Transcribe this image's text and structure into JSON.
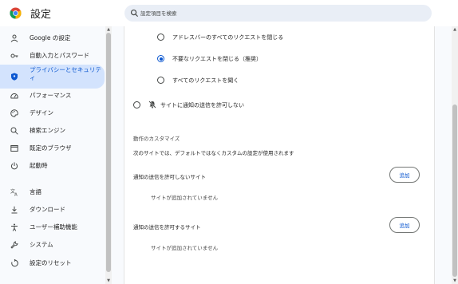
{
  "header": {
    "title": "設定",
    "search_placeholder": "設定項目を検索"
  },
  "sidebar": {
    "items": [
      {
        "label": "Google の設定",
        "icon": "person-icon"
      },
      {
        "label": "自動入力とパスワード",
        "icon": "key-icon"
      },
      {
        "label": "プライバシーとセキュリティ",
        "icon": "shield-icon",
        "active": true
      },
      {
        "label": "パフォーマンス",
        "icon": "speedometer-icon"
      },
      {
        "label": "デザイン",
        "icon": "palette-icon"
      },
      {
        "label": "検索エンジン",
        "icon": "search-icon"
      },
      {
        "label": "既定のブラウザ",
        "icon": "browser-window-icon"
      },
      {
        "label": "起動時",
        "icon": "power-icon"
      },
      {
        "label": "言語",
        "icon": "translate-icon"
      },
      {
        "label": "ダウンロード",
        "icon": "download-icon"
      },
      {
        "label": "ユーザー補助機能",
        "icon": "accessibility-icon"
      },
      {
        "label": "システム",
        "icon": "wrench-icon"
      },
      {
        "label": "設定のリセット",
        "icon": "reset-icon"
      }
    ]
  },
  "main": {
    "radio_options": [
      {
        "label": "アドレスバーのすべてのリクエストを閉じる",
        "checked": false
      },
      {
        "label": "不要なリクエストを閉じる（推奨）",
        "checked": true
      },
      {
        "label": "すべてのリクエストを聞く",
        "checked": false
      }
    ],
    "block_option": {
      "label": "サイトに通知の送信を許可しない",
      "checked": false
    },
    "customize": {
      "title": "動作のカスタマイズ",
      "description": "次のサイトでは、デフォルトではなくカスタムの設定が使用されます"
    },
    "not_allowed": {
      "title": "通知の送信を許可しないサイト",
      "add_label": "追加",
      "empty_text": "サイトが追加されていません"
    },
    "allowed": {
      "title": "通知の送信を許可するサイト",
      "add_label": "追加",
      "empty_text": "サイトが追加されていません"
    }
  },
  "colors": {
    "accent": "#0b57d0",
    "active_nav_bg": "#d3e3fd",
    "search_bg": "#e9eef6"
  }
}
